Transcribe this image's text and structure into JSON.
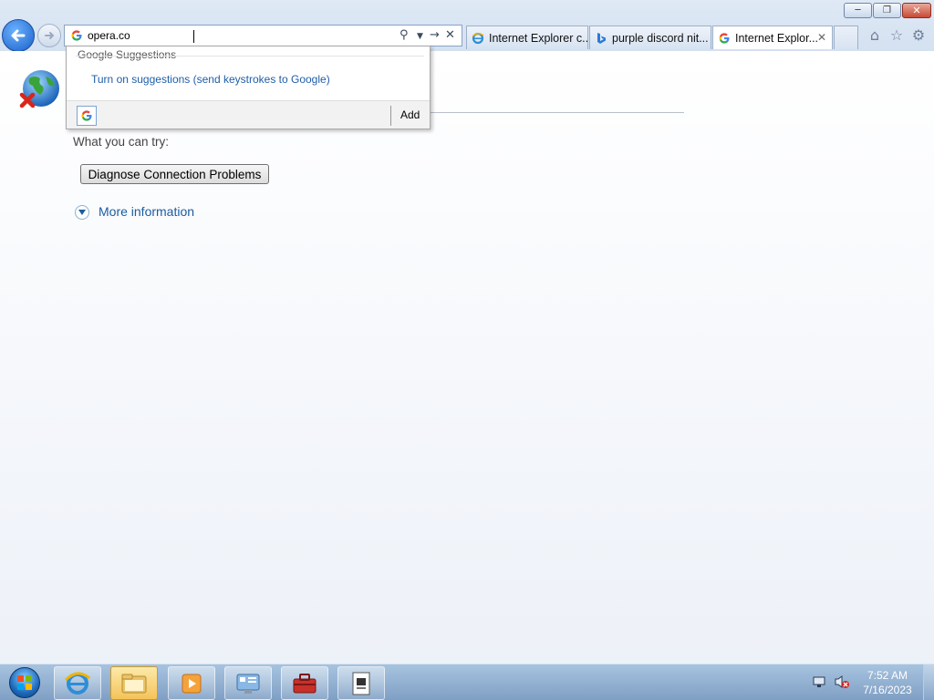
{
  "browser": {
    "address_value": "opera.co",
    "tabs": [
      {
        "label": "Internet Explorer c..."
      },
      {
        "label": "purple discord nit..."
      },
      {
        "label": "Internet Explor..."
      }
    ]
  },
  "suggestions": {
    "header": "Google Suggestions",
    "turn_on": "Turn on suggestions (send keystrokes to Google)",
    "add_label": "Add"
  },
  "page": {
    "try_text": "What you can try:",
    "diagnose_button": "Diagnose Connection Problems",
    "more_info": "More information"
  },
  "taskbar": {
    "time": "7:52 AM",
    "date": "7/16/2023"
  },
  "colors": {
    "link": "#1b5c9e",
    "accent": "#1a5fc8"
  }
}
